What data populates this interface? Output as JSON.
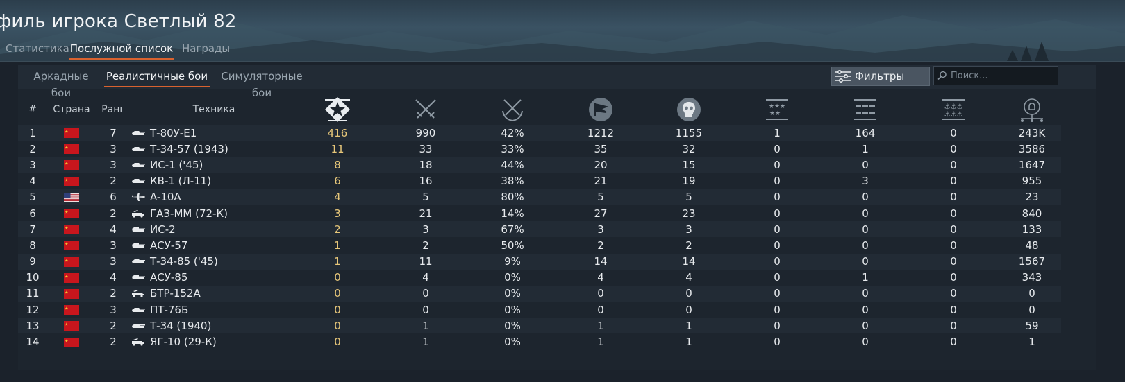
{
  "page": {
    "title": "филь игрока Светлый 82"
  },
  "tabs_top": [
    {
      "label": "Статистика",
      "active": false
    },
    {
      "label": "Послужной список",
      "active": true
    },
    {
      "label": "Награды",
      "active": false
    }
  ],
  "tabs_mode": [
    {
      "label": "Аркадные бои",
      "active": false
    },
    {
      "label": "Реалистичные бои",
      "active": true
    },
    {
      "label": "Симуляторные бои",
      "active": false
    }
  ],
  "toolbar": {
    "filter_label": "Фильтры",
    "search_placeholder": "Поиск..."
  },
  "table": {
    "headers": {
      "index": "#",
      "country": "Страна",
      "rank": "Ранг",
      "vehicle": "Техника",
      "icon_columns": [
        "kills-star-icon",
        "crossed-swords-icon",
        "swords-laurel-icon",
        "flag-circle-icon",
        "skull-icon",
        "stars-row-icon",
        "tanks-row-icon",
        "anchors-row-icon",
        "lightbulb-network-icon"
      ]
    },
    "rows": [
      {
        "n": "1",
        "country": "ussr",
        "rank": "7",
        "vehicle": "Т-80У-Е1",
        "vtype": "tank",
        "c1": "416",
        "c2": "990",
        "c3": "42%",
        "c4": "1212",
        "c5": "1155",
        "c6": "1",
        "c7": "164",
        "c8": "0",
        "c9": "243K"
      },
      {
        "n": "2",
        "country": "ussr",
        "rank": "3",
        "vehicle": "Т-34-57 (1943)",
        "vtype": "tank",
        "c1": "11",
        "c2": "33",
        "c3": "33%",
        "c4": "35",
        "c5": "32",
        "c6": "0",
        "c7": "1",
        "c8": "0",
        "c9": "3586"
      },
      {
        "n": "3",
        "country": "ussr",
        "rank": "3",
        "vehicle": "ИС-1 ('45)",
        "vtype": "tank",
        "c1": "8",
        "c2": "18",
        "c3": "44%",
        "c4": "20",
        "c5": "15",
        "c6": "0",
        "c7": "0",
        "c8": "0",
        "c9": "1647"
      },
      {
        "n": "4",
        "country": "ussr",
        "rank": "2",
        "vehicle": "КВ-1 (Л-11)",
        "vtype": "tank",
        "c1": "6",
        "c2": "16",
        "c3": "38%",
        "c4": "21",
        "c5": "19",
        "c6": "0",
        "c7": "3",
        "c8": "0",
        "c9": "955"
      },
      {
        "n": "5",
        "country": "usa",
        "rank": "6",
        "vehicle": "A-10A",
        "vtype": "plane",
        "c1": "4",
        "c2": "5",
        "c3": "80%",
        "c4": "5",
        "c5": "5",
        "c6": "0",
        "c7": "0",
        "c8": "0",
        "c9": "23"
      },
      {
        "n": "6",
        "country": "ussr",
        "rank": "2",
        "vehicle": "ГАЗ-ММ (72-К)",
        "vtype": "spaa",
        "c1": "3",
        "c2": "21",
        "c3": "14%",
        "c4": "27",
        "c5": "23",
        "c6": "0",
        "c7": "0",
        "c8": "0",
        "c9": "840"
      },
      {
        "n": "7",
        "country": "ussr",
        "rank": "4",
        "vehicle": "ИС-2",
        "vtype": "td",
        "c1": "2",
        "c2": "3",
        "c3": "67%",
        "c4": "3",
        "c5": "3",
        "c6": "0",
        "c7": "0",
        "c8": "0",
        "c9": "133"
      },
      {
        "n": "8",
        "country": "ussr",
        "rank": "3",
        "vehicle": "АСУ-57",
        "vtype": "td",
        "c1": "1",
        "c2": "2",
        "c3": "50%",
        "c4": "2",
        "c5": "2",
        "c6": "0",
        "c7": "0",
        "c8": "0",
        "c9": "48"
      },
      {
        "n": "9",
        "country": "ussr",
        "rank": "3",
        "vehicle": "Т-34-85 ('45)",
        "vtype": "tank",
        "c1": "1",
        "c2": "11",
        "c3": "9%",
        "c4": "14",
        "c5": "14",
        "c6": "0",
        "c7": "0",
        "c8": "0",
        "c9": "1567"
      },
      {
        "n": "10",
        "country": "ussr",
        "rank": "4",
        "vehicle": "АСУ-85",
        "vtype": "td",
        "c1": "0",
        "c2": "4",
        "c3": "0%",
        "c4": "4",
        "c5": "4",
        "c6": "0",
        "c7": "1",
        "c8": "0",
        "c9": "343"
      },
      {
        "n": "11",
        "country": "ussr",
        "rank": "2",
        "vehicle": "БТР-152А",
        "vtype": "spaa",
        "c1": "0",
        "c2": "0",
        "c3": "0%",
        "c4": "0",
        "c5": "0",
        "c6": "0",
        "c7": "0",
        "c8": "0",
        "c9": "0"
      },
      {
        "n": "12",
        "country": "ussr",
        "rank": "3",
        "vehicle": "ПТ-76Б",
        "vtype": "tank",
        "c1": "0",
        "c2": "0",
        "c3": "0%",
        "c4": "0",
        "c5": "0",
        "c6": "0",
        "c7": "0",
        "c8": "0",
        "c9": "0"
      },
      {
        "n": "13",
        "country": "ussr",
        "rank": "2",
        "vehicle": "Т-34 (1940)",
        "vtype": "tank",
        "c1": "0",
        "c2": "1",
        "c3": "0%",
        "c4": "1",
        "c5": "1",
        "c6": "0",
        "c7": "0",
        "c8": "0",
        "c9": "59"
      },
      {
        "n": "14",
        "country": "ussr",
        "rank": "2",
        "vehicle": "ЯГ-10 (29-К)",
        "vtype": "spaa",
        "c1": "0",
        "c2": "1",
        "c3": "0%",
        "c4": "1",
        "c5": "1",
        "c6": "0",
        "c7": "0",
        "c8": "0",
        "c9": "1"
      }
    ]
  },
  "colors": {
    "accent": "#d9622f",
    "kills": "#e7c77a",
    "ussr_red": "#c8161d"
  }
}
